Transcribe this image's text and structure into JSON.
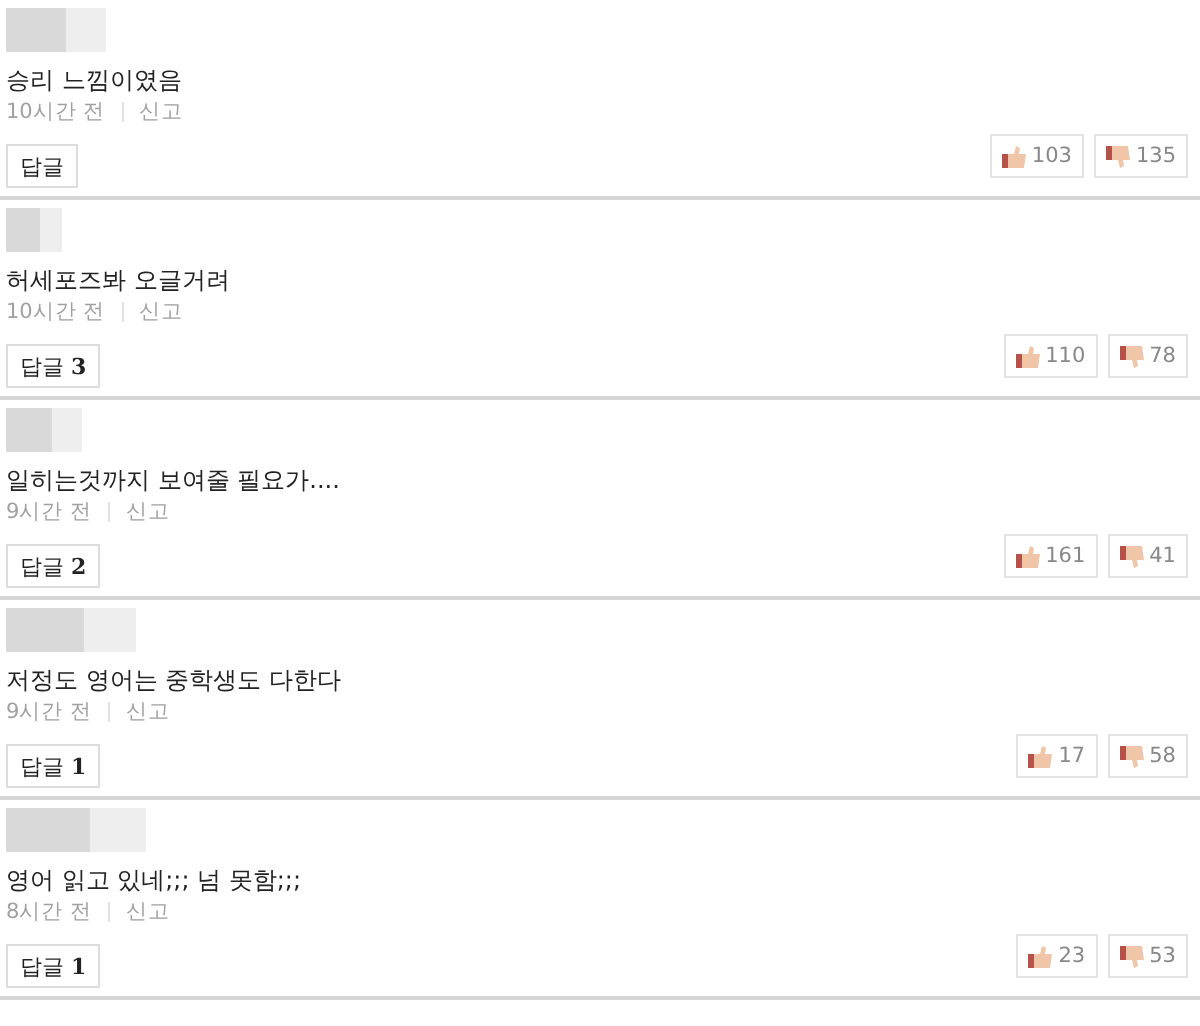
{
  "comments": [
    {
      "text": "승리 느낌이였음",
      "time": "10시간 전",
      "report": "신고",
      "reply": {
        "label": "답글"
      },
      "likes": "103",
      "dislikes": "135"
    },
    {
      "text": "허세포즈봐 오글거려",
      "time": "10시간 전",
      "report": "신고",
      "reply": {
        "label": "답글",
        "count": "3"
      },
      "likes": "110",
      "dislikes": "78"
    },
    {
      "text": "일히는것까지 보여줄 필요가....",
      "time": "9시간 전",
      "report": "신고",
      "reply": {
        "label": "답글",
        "count": "2"
      },
      "likes": "161",
      "dislikes": "41"
    },
    {
      "text": "저정도 영어는 중학생도 다한다",
      "time": "9시간 전",
      "report": "신고",
      "reply": {
        "label": "답글",
        "count": "1"
      },
      "likes": "17",
      "dislikes": "58"
    },
    {
      "text": "영어 읽고 있네;;; 넘 못함;;;",
      "time": "8시간 전",
      "report": "신고",
      "reply": {
        "label": "답글",
        "count": "1"
      },
      "likes": "23",
      "dislikes": "53"
    }
  ]
}
